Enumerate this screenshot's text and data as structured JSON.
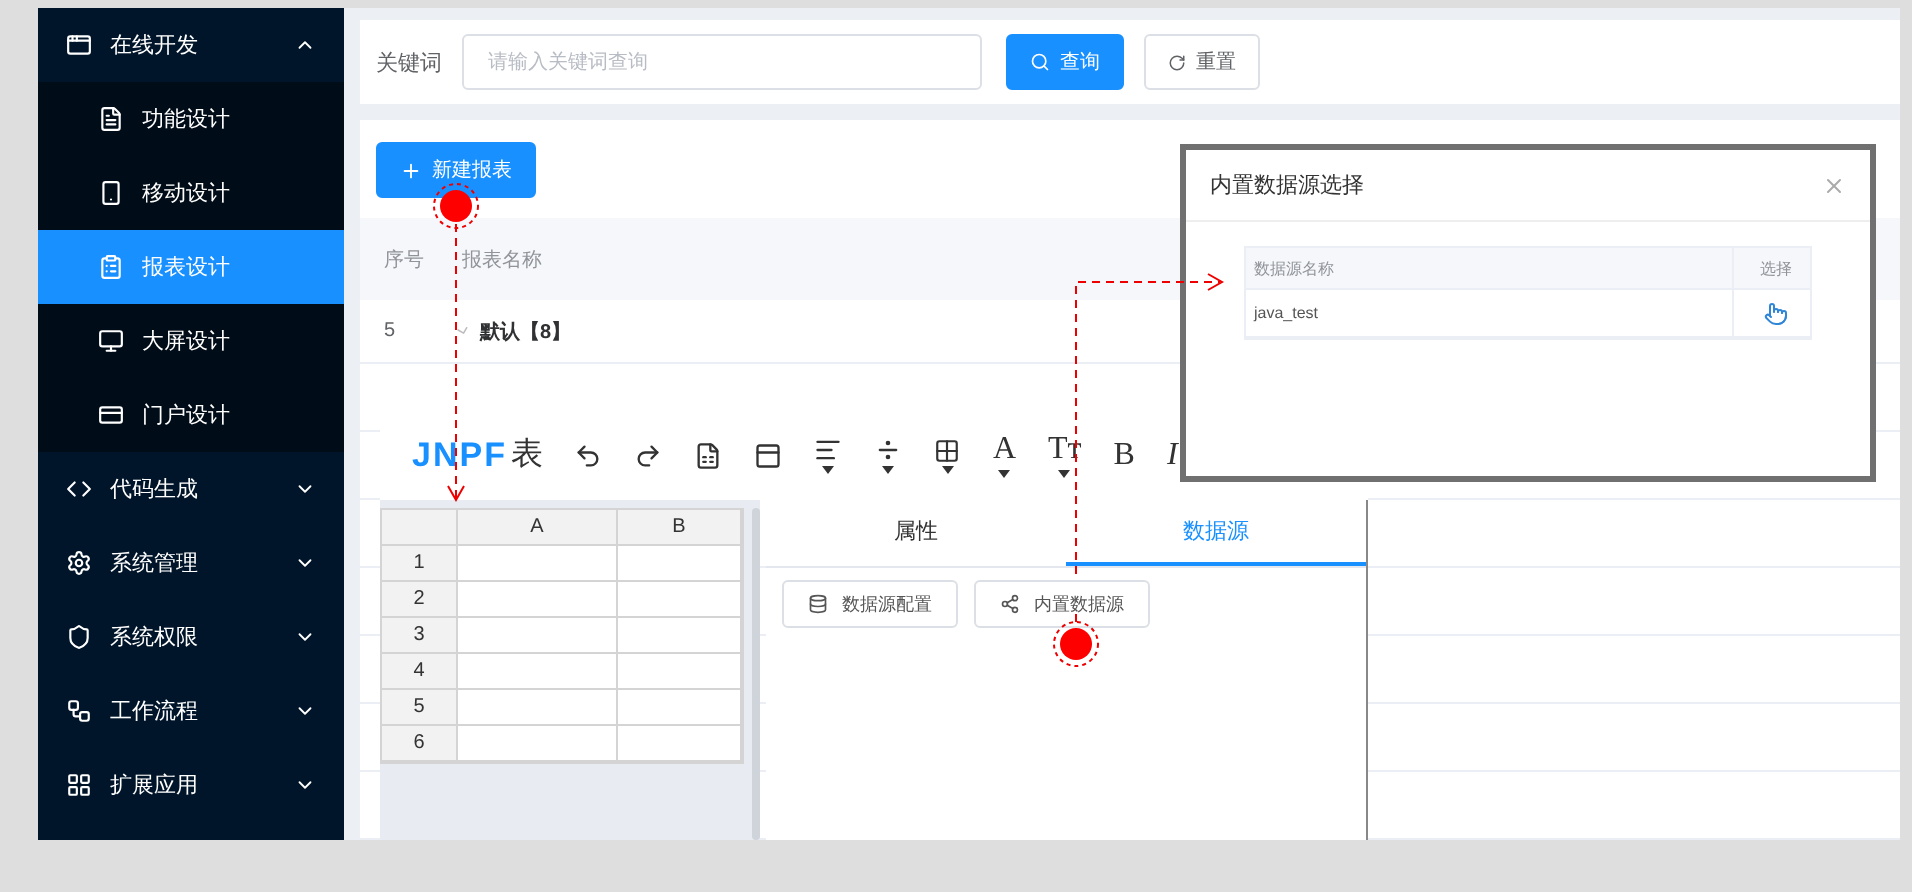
{
  "sidebar": {
    "items": [
      {
        "label": "在线开发",
        "expanded": true,
        "selected": false,
        "children": [
          {
            "label": "功能设计",
            "selected": false
          },
          {
            "label": "移动设计",
            "selected": false
          },
          {
            "label": "报表设计",
            "selected": true
          },
          {
            "label": "大屏设计",
            "selected": false
          },
          {
            "label": "门户设计",
            "selected": false
          }
        ]
      },
      {
        "label": "代码生成",
        "expanded": false,
        "selected": false
      },
      {
        "label": "系统管理",
        "expanded": false,
        "selected": false
      },
      {
        "label": "系统权限",
        "expanded": false,
        "selected": false
      },
      {
        "label": "工作流程",
        "expanded": false,
        "selected": false
      },
      {
        "label": "扩展应用",
        "expanded": false,
        "selected": false
      }
    ]
  },
  "search": {
    "label": "关键词",
    "placeholder": "请输入关键词查询",
    "buttons": [
      {
        "label": "查询",
        "kind": "primary"
      },
      {
        "label": "重置",
        "kind": "default"
      }
    ]
  },
  "table": {
    "new_button": "新建报表",
    "columns": [
      "序号",
      "报表名称"
    ],
    "rows": [
      {
        "index": "5",
        "name": "默认【8】",
        "expanded": false
      }
    ]
  },
  "editor": {
    "logo": "JNPF",
    "logo_suffix": "表",
    "format_buttons": [
      {
        "label": "A",
        "dropdown": true
      },
      {
        "label": "Tт",
        "dropdown": true
      },
      {
        "label": "B",
        "dropdown": false
      },
      {
        "label": "I",
        "dropdown": false
      }
    ],
    "grid": {
      "columns": [
        "A",
        "B"
      ],
      "rows": [
        "1",
        "2",
        "3",
        "4",
        "5",
        "6"
      ]
    },
    "tabs": [
      {
        "label": "属性",
        "selected": false
      },
      {
        "label": "数据源",
        "selected": true
      }
    ],
    "panel_buttons": [
      "数据源配置",
      "内置数据源"
    ]
  },
  "dialog": {
    "title": "内置数据源选择",
    "columns": [
      "数据源名称",
      "选择"
    ],
    "rows": [
      {
        "name": "java_test"
      }
    ]
  }
}
